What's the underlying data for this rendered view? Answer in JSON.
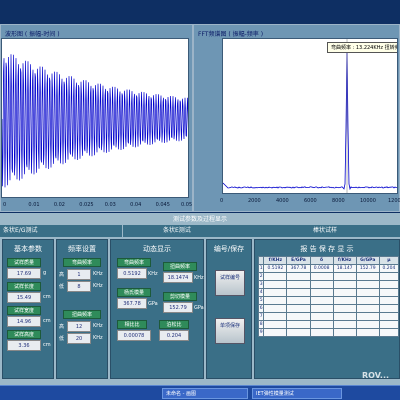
{
  "time_panel": {
    "title": "波形图 ( 振幅-时间 )",
    "x_ticks": [
      "0",
      "0.01",
      "0.02",
      "0.025",
      "0.03",
      "0.04",
      "0.045",
      "0.05"
    ]
  },
  "fft_panel": {
    "title": "FFT频谱图 ( 振幅-频率 )",
    "tooltip": "弯曲频率 : 13.224KHz  扭转频",
    "x_ticks": [
      "0",
      "2000",
      "4000",
      "6000",
      "8000",
      "10000",
      "12000"
    ]
  },
  "lower": {
    "title": "测试参数及过程显示",
    "tabs": [
      "条状E/G测试",
      "条状E测试",
      "棒状试样"
    ],
    "groups": {
      "basic_params": {
        "title": "基本参数",
        "rows": [
          {
            "label": "试样质量",
            "value": "17.69",
            "unit": "g"
          },
          {
            "label": "试样长度",
            "value": "15.49",
            "unit": "cm"
          },
          {
            "label": "试样宽度",
            "value": "14.96",
            "unit": "cm"
          },
          {
            "label": "试样高度",
            "value": "3.36",
            "unit": "cm"
          }
        ]
      },
      "freq_settings": {
        "title": "频率设置",
        "flex_label": "弯曲频率",
        "flex_high_label": "高",
        "flex_high_value": "1",
        "flex_low_label": "低",
        "flex_low_value": "8",
        "unit": "KHz",
        "torsion_label": "扭曲频率",
        "torsion_high_label": "高",
        "torsion_high_value": "12",
        "torsion_low_label": "低",
        "torsion_low_value": "20"
      },
      "dynamic": {
        "title": "动态显示",
        "flex_freq_label": "弯曲频率",
        "flex_freq_value": "0.5192",
        "flex_freq_unit": "KHz",
        "torsion_freq_label": "扭曲频率",
        "torsion_freq_value": "18.1474",
        "torsion_freq_unit": "KHz",
        "youngs_label": "杨氏模量",
        "youngs_value": "367.78",
        "youngs_unit": "GPa",
        "shear_label": "剪切模量",
        "shear_value": "152.79",
        "shear_unit": "GPa",
        "ratio_label": "相比比",
        "ratio_value": "0.00078",
        "poisson_label": "泊松比",
        "poisson_value": "0.204"
      },
      "number_save": {
        "title": "编号/保存",
        "btn_number": "试样编号",
        "btn_save": "单项保存"
      },
      "results": {
        "title": "报 告 保 存 显 示",
        "headers": [
          "",
          "f/KHz",
          "E/GPa",
          "δ",
          "f/KHz",
          "G/GPa",
          "μ"
        ],
        "rows": [
          [
            "1",
            "0.5192",
            "367.78",
            "0.0008",
            "18.147",
            "152.79",
            "0.204"
          ],
          [
            "2",
            "",
            "",
            "",
            "",
            "",
            ""
          ],
          [
            "3",
            "",
            "",
            "",
            "",
            "",
            ""
          ],
          [
            "4",
            "",
            "",
            "",
            "",
            "",
            ""
          ],
          [
            "5",
            "",
            "",
            "",
            "",
            "",
            ""
          ],
          [
            "6",
            "",
            "",
            "",
            "",
            "",
            ""
          ],
          [
            "7",
            "",
            "",
            "",
            "",
            "",
            ""
          ],
          [
            "8",
            "",
            "",
            "",
            "",
            "",
            ""
          ],
          [
            "9",
            "",
            "",
            "",
            "",
            "",
            ""
          ]
        ]
      }
    }
  },
  "taskbar": {
    "items": [
      "未命名 - 画图",
      "IET弹性模量测试"
    ]
  },
  "watermark": "ROV...",
  "colors": {
    "background": "#0e2f63",
    "panel": "#3a6f87",
    "label_green": "#2f8b5a",
    "trace": "#0000cc"
  }
}
